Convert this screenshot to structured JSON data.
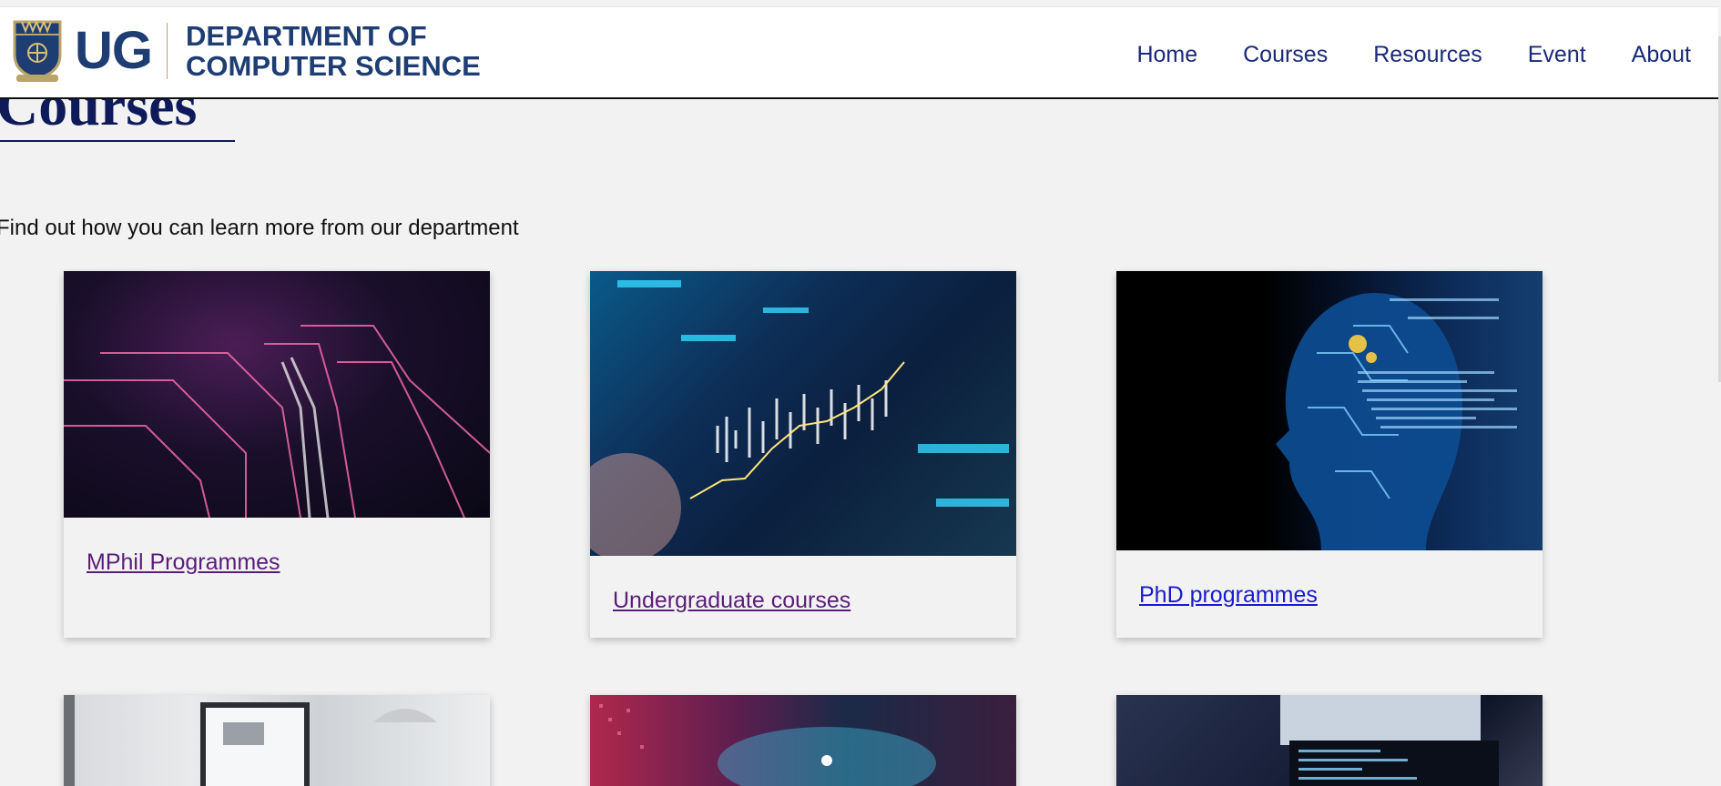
{
  "brand": {
    "short": "UG",
    "dept_line1": "DEPARTMENT OF",
    "dept_line2": "COMPUTER SCIENCE"
  },
  "nav": [
    {
      "label": "Home"
    },
    {
      "label": "Courses"
    },
    {
      "label": "Resources"
    },
    {
      "label": "Event"
    },
    {
      "label": "About"
    }
  ],
  "page": {
    "title": "Courses",
    "intro": "Find out how you can learn more from our department"
  },
  "cards": [
    {
      "label": "MPhil Programmes"
    },
    {
      "label": "Undergraduate courses"
    },
    {
      "label": "PhD programmes"
    }
  ],
  "colors": {
    "brand_blue": "#1d3d73",
    "title_navy": "#0e1a5a",
    "visited_link": "#5a1d7a",
    "link": "#1a1ad0",
    "background": "#f2f2f2"
  }
}
